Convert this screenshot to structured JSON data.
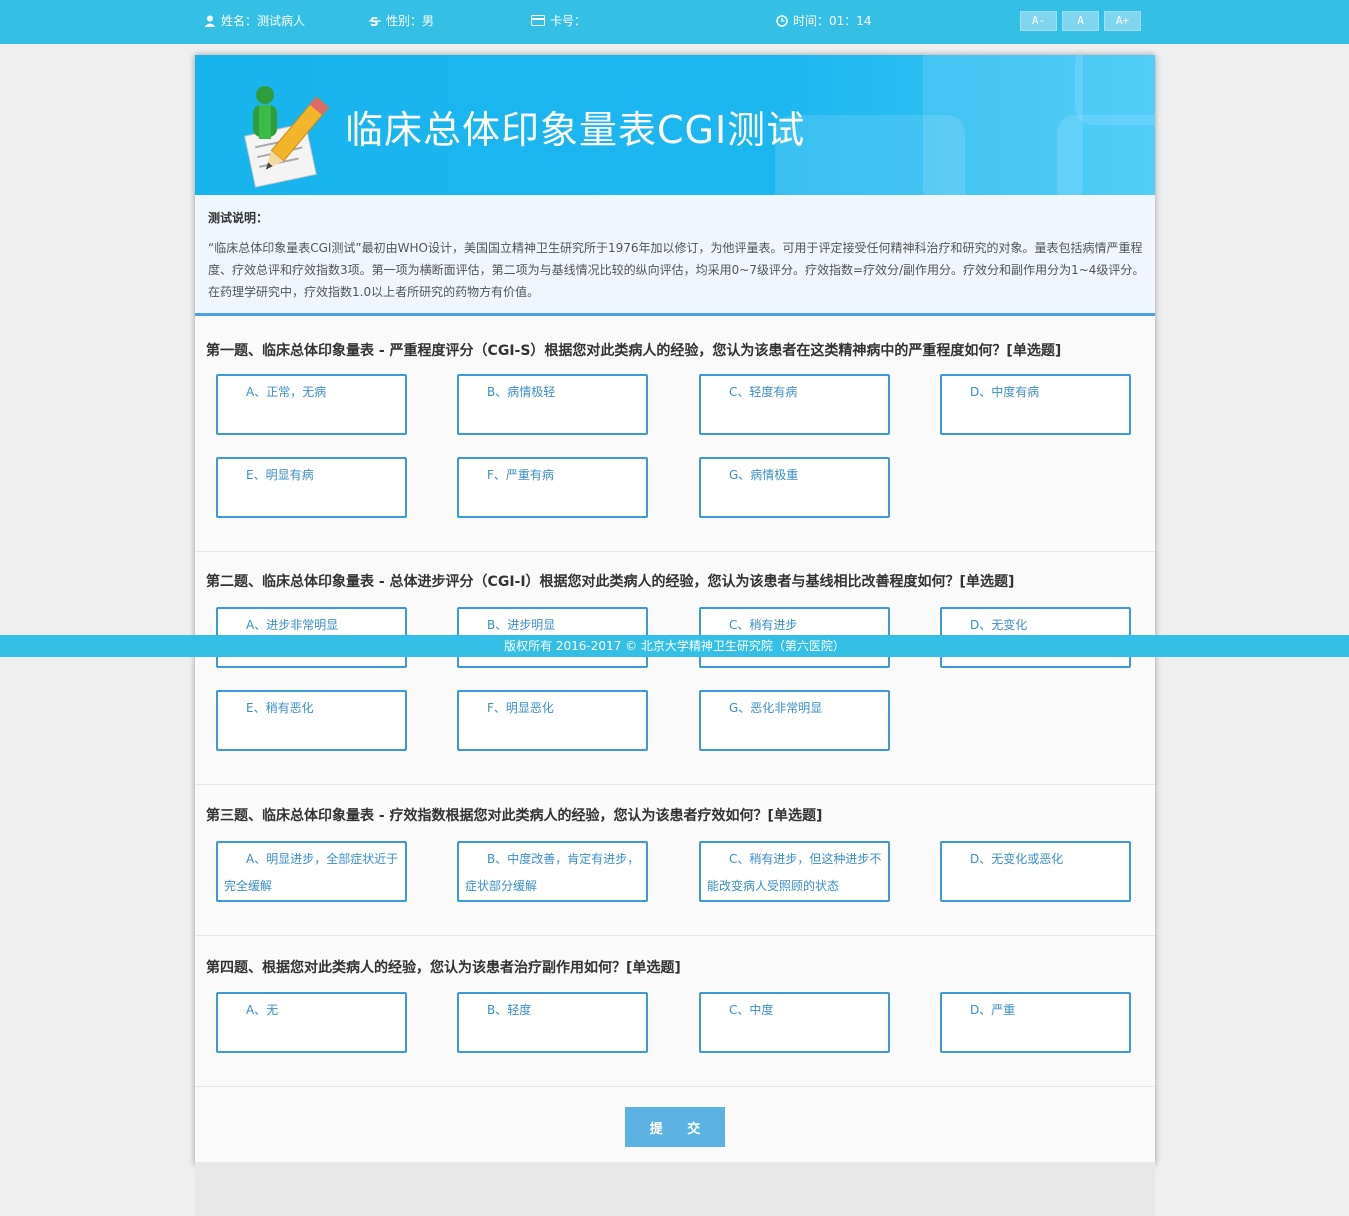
{
  "topbar": {
    "name_label": "姓名：测试病人",
    "gender_label": "性别：男",
    "card_label": "卡号：",
    "time_label": "时间：01：14",
    "font_smaller": "A-",
    "font_normal": "A",
    "font_larger": "A+"
  },
  "banner": {
    "title": "临床总体印象量表CGI测试"
  },
  "description": {
    "heading": "测试说明：",
    "text": "“临床总体印象量表CGI测试”最初由WHO设计，美国国立精神卫生研究所于1976年加以修订，为他评量表。可用于评定接受任何精神科治疗和研究的对象。量表包括病情严重程度、疗效总评和疗效指数3项。第一项为横断面评估，第二项为与基线情况比较的纵向评估，均采用0~7级评分。疗效指数=疗效分/副作用分。疗效分和副作用分为1~4级评分。在药理学研究中，疗效指数1.0以上者所研究的药物方有价值。"
  },
  "questions": [
    {
      "title": "第一题、临床总体印象量表 - 严重程度评分（CGI-S）根据您对此类病人的经验，您认为该患者在这类精神病中的严重程度如何？[单选题]",
      "options": [
        "A、正常，无病",
        "B、病情极轻",
        "C、轻度有病",
        "D、中度有病",
        "E、明显有病",
        "F、严重有病",
        "G、病情极重"
      ]
    },
    {
      "title": "第二题、临床总体印象量表 - 总体进步评分（CGI-I）根据您对此类病人的经验，您认为该患者与基线相比改善程度如何？[单选题]",
      "options": [
        "A、进步非常明显",
        "B、进步明显",
        "C、稍有进步",
        "D、无变化",
        "E、稍有恶化",
        "F、明显恶化",
        "G、恶化非常明显"
      ]
    },
    {
      "title": "第三题、临床总体印象量表 - 疗效指数根据您对此类病人的经验，您认为该患者疗效如何？[单选题]",
      "options": [
        "A、明显进步，全部症状近于完全缓解",
        "B、中度改善，肯定有进步，症状部分缓解",
        "C、稍有进步，但这种进步不能改变病人受照顾的状态",
        "D、无变化或恶化"
      ]
    },
    {
      "title": "第四题、根据您对此类病人的经验，您认为该患者治疗副作用如何？[单选题]",
      "options": [
        "A、无",
        "B、轻度",
        "C、中度",
        "D、严重"
      ]
    }
  ],
  "submit_label": "提 交",
  "footer": {
    "text": "版权所有 2016-2017 © 北京大学精神卫生研究院（第六医院）"
  },
  "colors": {
    "topbar": "#33bfe6",
    "option_border": "#3c9ad8",
    "submit": "#5cb3e3"
  },
  "icons": [
    "user-icon",
    "gender-icon",
    "card-icon",
    "clock-icon",
    "pencil-logo-icon"
  ]
}
